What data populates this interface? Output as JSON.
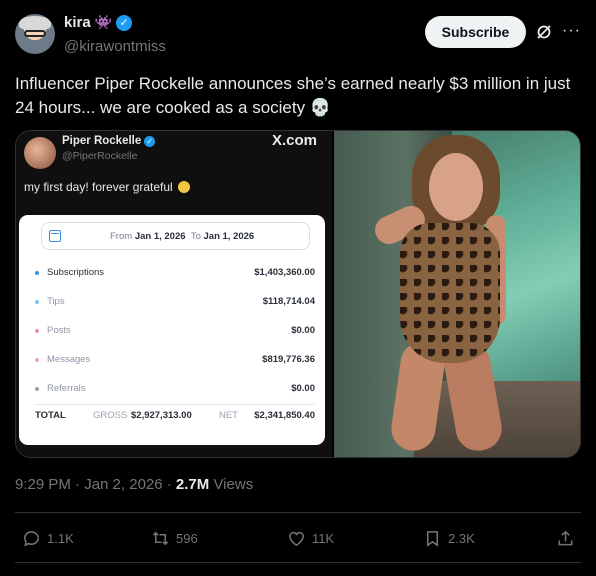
{
  "author": {
    "name": "kira",
    "emoji": "👾",
    "handle": "@kirawontmiss"
  },
  "header": {
    "subscribe_label": "Subscribe"
  },
  "tweet": {
    "text": "Influencer Piper Rockelle announces she’s earned nearly $3 million in just 24 hours... we are cooked as a society 💀",
    "timestamp": "9:29 PM · Jan 2, 2026 · ",
    "views_count": "2.7M",
    "views_label": " Views"
  },
  "embedded": {
    "name": "Piper Rockelle",
    "handle": "@PiperRockelle",
    "site": "X.com",
    "text": "my first day! forever grateful",
    "date_from_label": "From",
    "date_from": "Jan 1, 2026",
    "date_to_label": "To",
    "date_to": "Jan 1, 2026",
    "rows": [
      {
        "label": "Subscriptions",
        "value": "$1,403,360.00",
        "color": "#3d8ee6"
      },
      {
        "label": "Tips",
        "value": "$118,714.04",
        "color": "#7fc4f0"
      },
      {
        "label": "Posts",
        "value": "$0.00",
        "color": "#f08fa0"
      },
      {
        "label": "Messages",
        "value": "$819,776.36",
        "color": "#f5a4b0"
      },
      {
        "label": "Referrals",
        "value": "$0.00",
        "color": "#9aa1ae"
      }
    ],
    "total_label": "TOTAL",
    "gross_label": "GROSS",
    "gross_value": "$2,927,313.00",
    "net_label": "NET",
    "net_value": "$2,341,850.40"
  },
  "actions": {
    "replies": "1.1K",
    "reposts": "596",
    "likes": "11K",
    "bookmarks": "2.3K"
  },
  "colors": {
    "background": "#000000",
    "text_primary": "#e7e9ea",
    "text_secondary": "#71767b",
    "verified": "#1d9bf0",
    "divider": "#2f3336"
  }
}
